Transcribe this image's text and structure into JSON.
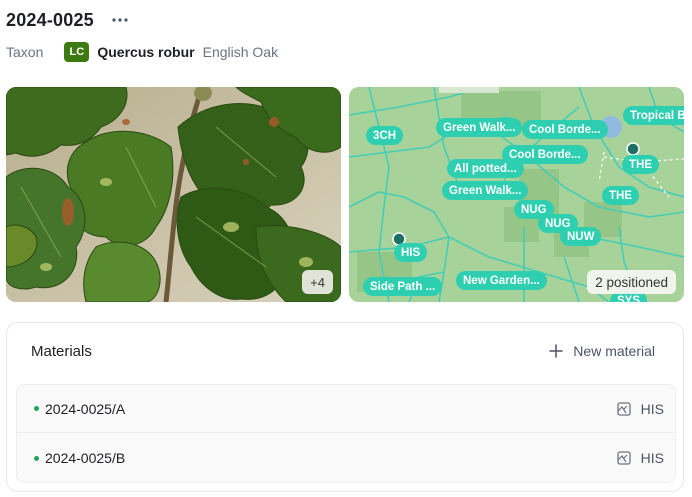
{
  "header": {
    "title": "2024-0025",
    "more_icon": "ellipsis-icon"
  },
  "taxon": {
    "label": "Taxon",
    "iucn_badge": "LC",
    "iucn_color": "#3d7a12",
    "scientific_name": "Quercus robur",
    "common_name": "English Oak"
  },
  "photos": {
    "more_count": "+4"
  },
  "map": {
    "labels": [
      "3CH",
      "Green Walk...",
      "Cool Borde...",
      "Tropical B",
      "Cool Borde...",
      "All potted...",
      "THE",
      "Green Walk...",
      "THE",
      "NUG",
      "NUG",
      "NUW",
      "HIS",
      "New Garden...",
      "Side Path ...",
      "SYS"
    ],
    "positioned": "2 positioned",
    "accent": "#2ecfb0"
  },
  "materials": {
    "title": "Materials",
    "new_label": "New material",
    "items": [
      {
        "id": "2024-0025/A",
        "location": "HIS"
      },
      {
        "id": "2024-0025/B",
        "location": "HIS"
      }
    ]
  }
}
